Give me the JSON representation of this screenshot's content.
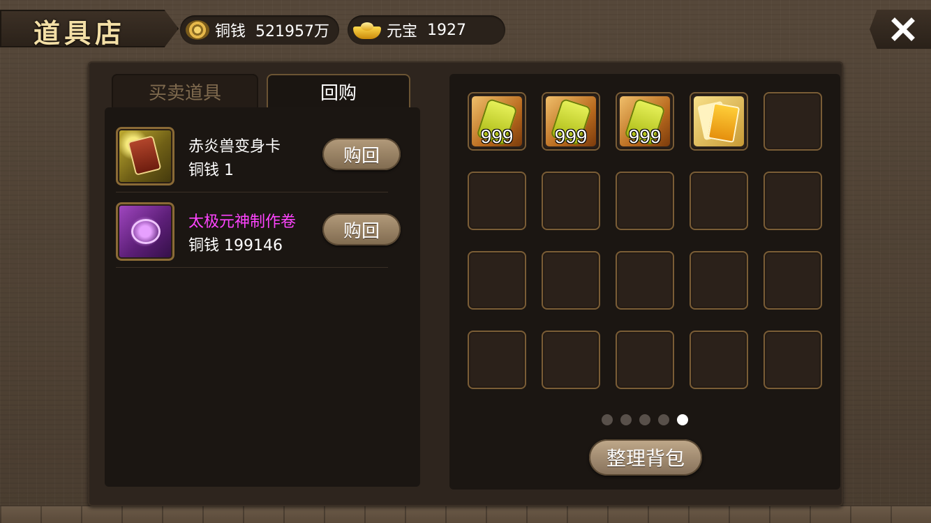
{
  "header": {
    "title": "道具店",
    "copper": {
      "icon": "coin-icon",
      "label": "铜钱",
      "value": "521957万"
    },
    "ingot": {
      "icon": "gold-ingot-icon",
      "label": "元宝",
      "value": "1927"
    },
    "close_icon": "close-icon"
  },
  "tabs": [
    {
      "label": "买卖道具",
      "active": false
    },
    {
      "label": "回购",
      "active": true
    }
  ],
  "buyback_items": [
    {
      "name": "赤炎兽变身卡",
      "name_color": "#ffffff",
      "price": "铜钱 1",
      "button": "购回",
      "icon": "transformation-card-icon"
    },
    {
      "name": "太极元神制作卷",
      "name_color": "#ff44ff",
      "price": "铜钱 199146",
      "button": "购回",
      "icon": "purple-scroll-icon"
    }
  ],
  "bag": {
    "slots": [
      {
        "icon": "green-talisman-icon",
        "qty": "999"
      },
      {
        "icon": "green-talisman-icon",
        "qty": "999"
      },
      {
        "icon": "green-talisman-icon",
        "qty": "999"
      },
      {
        "icon": "yellow-cards-icon",
        "qty": ""
      }
    ],
    "total_slots": 20,
    "pages": 5,
    "current_page": 5,
    "sort_button": "整理背包"
  }
}
